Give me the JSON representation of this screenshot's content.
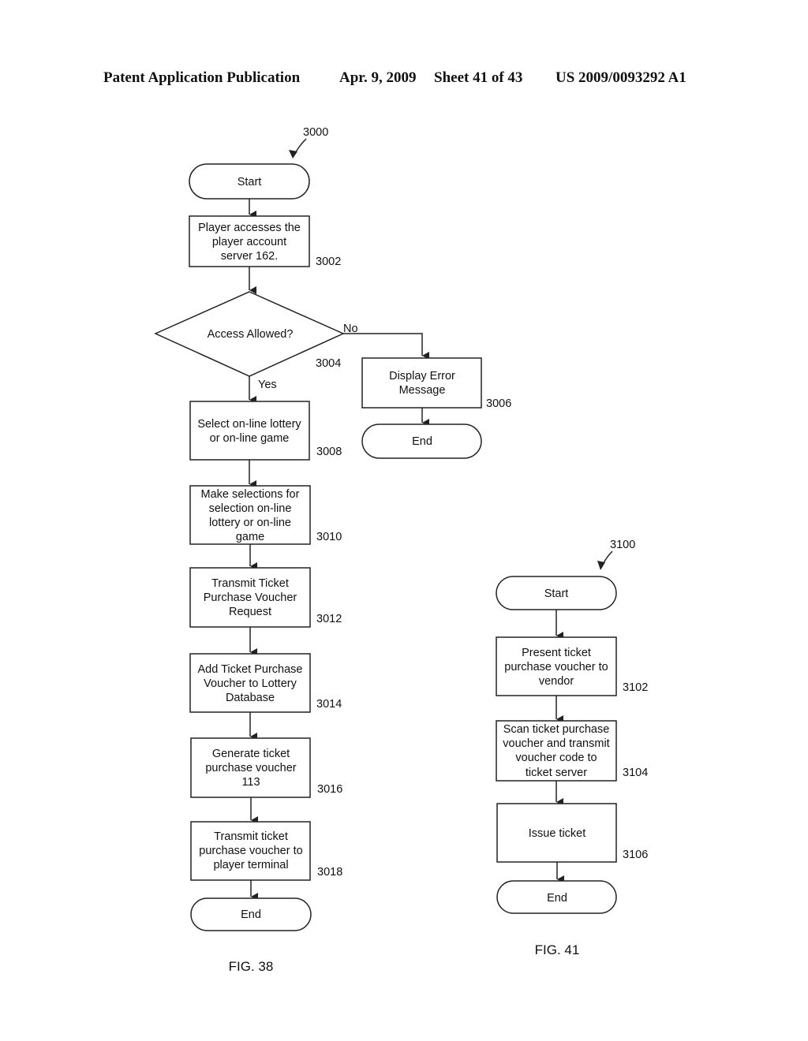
{
  "header": {
    "publication": "Patent Application Publication",
    "date": "Apr. 9, 2009",
    "sheet": "Sheet 41 of 43",
    "number": "US 2009/0093292 A1"
  },
  "fig38": {
    "ref": "3000",
    "caption": "FIG. 38",
    "start": "Start",
    "steps": [
      {
        "id": "3002",
        "lines": [
          "Player accesses the",
          "player account",
          "server 162."
        ]
      },
      {
        "id": "3004",
        "lines": [
          "Access Allowed?"
        ],
        "type": "decision",
        "yes": "Yes",
        "no": "No"
      },
      {
        "id": "3006",
        "lines": [
          "Display Error",
          "Message"
        ]
      },
      {
        "id": "3008",
        "lines": [
          "Select on-line lottery",
          "or on-line game"
        ]
      },
      {
        "id": "3010",
        "lines": [
          "Make selections for",
          "selection on-line",
          "lottery or on-line",
          "game"
        ]
      },
      {
        "id": "3012",
        "lines": [
          "Transmit Ticket",
          "Purchase Voucher",
          "Request"
        ]
      },
      {
        "id": "3014",
        "lines": [
          "Add Ticket Purchase",
          "Voucher to Lottery",
          "Database"
        ]
      },
      {
        "id": "3016",
        "lines": [
          "Generate ticket",
          "purchase voucher",
          "113"
        ]
      },
      {
        "id": "3018",
        "lines": [
          "Transmit ticket",
          "purchase voucher to",
          "player terminal"
        ]
      }
    ],
    "error_end": "End",
    "end": "End"
  },
  "fig41": {
    "ref": "3100",
    "caption": "FIG. 41",
    "start": "Start",
    "steps": [
      {
        "id": "3102",
        "lines": [
          "Present ticket",
          "purchase voucher to",
          "vendor"
        ]
      },
      {
        "id": "3104",
        "lines": [
          "Scan ticket purchase",
          "voucher and transmit",
          "voucher code to",
          "ticket server"
        ]
      },
      {
        "id": "3106",
        "lines": [
          "Issue ticket"
        ]
      }
    ],
    "end": "End"
  }
}
